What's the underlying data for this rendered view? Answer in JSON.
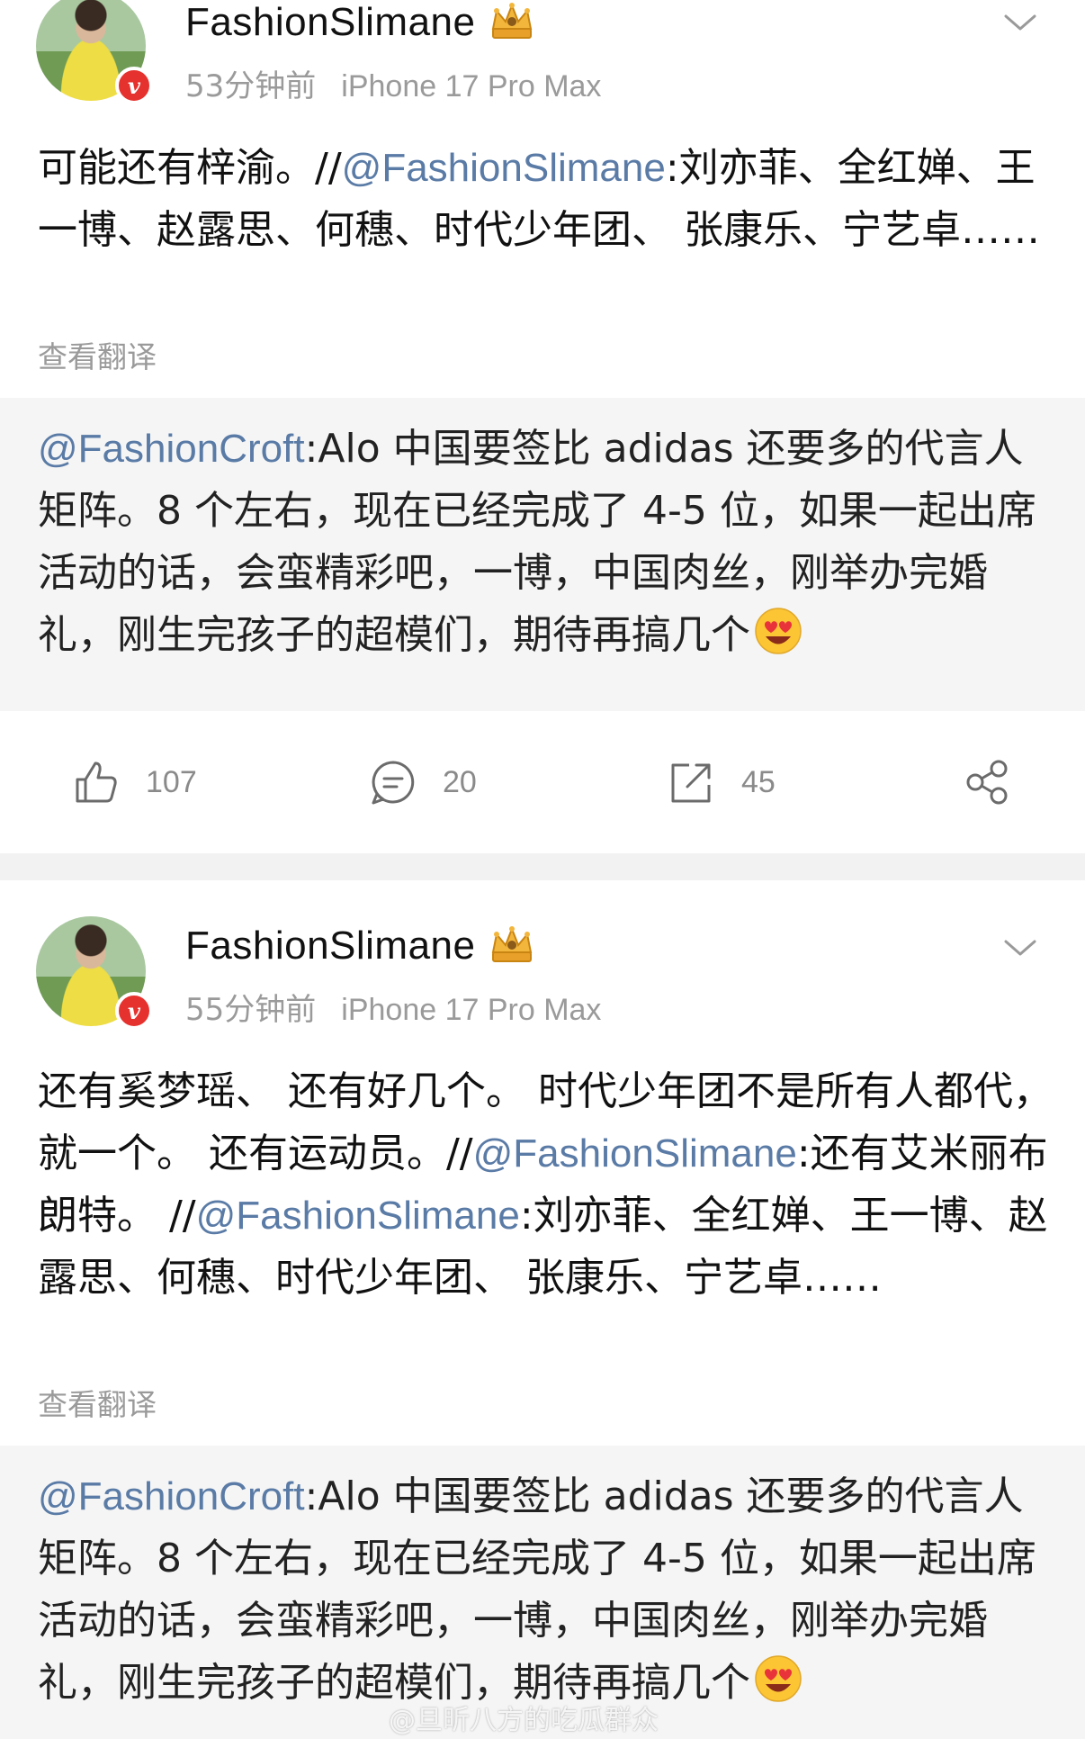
{
  "posts": [
    {
      "username": "FashionSlimane",
      "time": "53分钟前",
      "device": "iPhone 17 Pro Max",
      "text_parts": [
        {
          "text": "可能还有梓渝。//",
          "mention": false
        },
        {
          "text": "@FashionSlimane",
          "mention": true
        },
        {
          "text": ":刘亦菲、全红婵、王一博、赵露思、何穗、时代少年团、 张康乐、宁艺卓……",
          "mention": false
        }
      ],
      "translate_label": "查看翻译",
      "repost": {
        "mention": "@FashionCroft",
        "text": ":Alo 中国要签比 adidas 还要多的代言人矩阵。8 个左右，现在已经完成了 4-5 位，如果一起出席活动的话，会蛮精彩吧，一博，中国肉丝，刚举办完婚礼，刚生完孩子的超模们，期待再搞几个"
      },
      "actions": {
        "like_count": "107",
        "comment_count": "20",
        "repost_count": "45"
      }
    },
    {
      "username": "FashionSlimane",
      "time": "55分钟前",
      "device": "iPhone 17 Pro Max",
      "text_parts": [
        {
          "text": "还有奚梦瑶、 还有好几个。 时代少年团不是所有人都代， 就一个。 还有运动员。//",
          "mention": false
        },
        {
          "text": "@FashionSlimane",
          "mention": true
        },
        {
          "text": ":还有艾米丽布朗特。 //",
          "mention": false
        },
        {
          "text": "@FashionSlimane",
          "mention": true
        },
        {
          "text": ":刘亦菲、全红婵、王一博、赵露思、何穗、时代少年团、 张康乐、宁艺卓……",
          "mention": false
        }
      ],
      "translate_label": "查看翻译",
      "repost": {
        "mention": "@FashionCroft",
        "text": ":Alo 中国要签比 adidas 还要多的代言人矩阵。8 个左右，现在已经完成了 4-5 位，如果一起出席活动的话，会蛮精彩吧，一博，中国肉丝，刚举办完婚礼，刚生完孩子的超模们，期待再搞几个"
      }
    }
  ],
  "watermark": "@旦昕八方的吃瓜群众",
  "colors": {
    "mention": "#5a7ba6",
    "verify_badge": "#e6322e",
    "meta_text": "#9a9a9a",
    "repost_bg": "#f5f5f5"
  },
  "icons": [
    "crown-icon",
    "chevron-down-icon",
    "like-icon",
    "comment-icon",
    "repost-icon",
    "share-icon",
    "heart-eyes-emoji"
  ]
}
